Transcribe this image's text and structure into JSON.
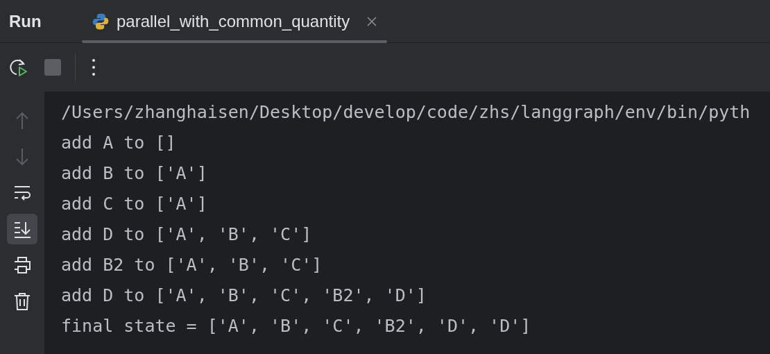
{
  "panel": {
    "title": "Run"
  },
  "tabs": [
    {
      "label": "parallel_with_common_quantity",
      "selected": true
    }
  ],
  "toolbar": [
    {
      "kind": "rerun",
      "disabled": false
    },
    {
      "kind": "stop",
      "disabled": true
    },
    {
      "kind": "more",
      "disabled": false
    }
  ],
  "side_tools": [
    {
      "kind": "up",
      "disabled": true,
      "selected": false
    },
    {
      "kind": "down",
      "disabled": true,
      "selected": false
    },
    {
      "kind": "wrap",
      "disabled": false,
      "selected": false
    },
    {
      "kind": "scroll-end",
      "disabled": false,
      "selected": true
    },
    {
      "kind": "print",
      "disabled": false,
      "selected": false
    },
    {
      "kind": "trash",
      "disabled": false,
      "selected": false
    }
  ],
  "console_lines": [
    "/Users/zhanghaisen/Desktop/develop/code/zhs/langgraph/env/bin/pyth",
    "add A to []",
    "add B to ['A']",
    "add C to ['A']",
    "add D to ['A', 'B', 'C']",
    "add B2 to ['A', 'B', 'C']",
    "add D to ['A', 'B', 'C', 'B2', 'D']",
    "final state = ['A', 'B', 'C', 'B2', 'D', 'D']"
  ]
}
